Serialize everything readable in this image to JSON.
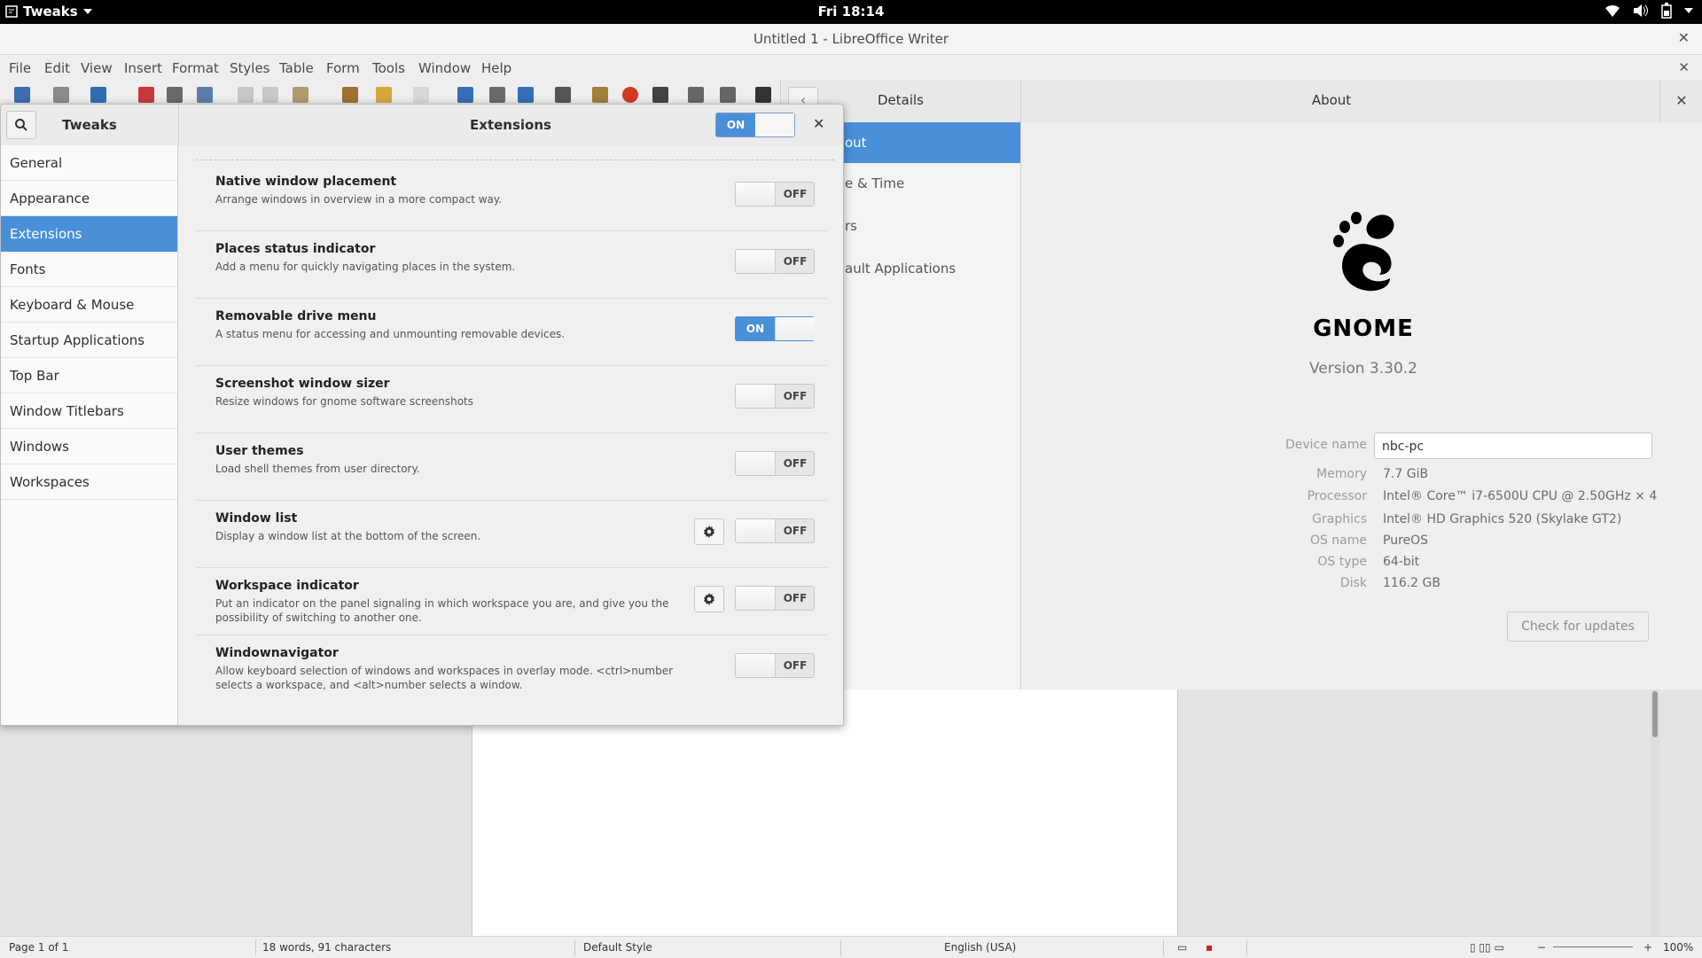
{
  "topbar": {
    "app_name": "Tweaks",
    "clock": "Fri 18:14",
    "icons": [
      "wifi-icon",
      "volume-icon",
      "battery-icon",
      "system-menu-arrow-icon"
    ]
  },
  "writer": {
    "title": "Untitled 1 - LibreOffice Writer",
    "menu": [
      "File",
      "Edit",
      "View",
      "Insert",
      "Format",
      "Styles",
      "Table",
      "Form",
      "Tools",
      "Window",
      "Help"
    ],
    "status": {
      "page": "Page 1 of 1",
      "words": "18 words, 91 characters",
      "style": "Default Style",
      "language": "English (USA)",
      "zoom": "100%"
    }
  },
  "settings": {
    "details_title": "Details",
    "about_title": "About",
    "sidebar": [
      "out",
      "e & Time",
      "rs",
      "ault Applications"
    ],
    "logo_text": "GNOME",
    "version": "Version 3.30.2",
    "device_name_label": "Device name",
    "device_name_value": "nbc-pc",
    "memory_label": "Memory",
    "memory_value": "7.7 GiB",
    "processor_label": "Processor",
    "processor_value": "Intel® Core™ i7-6500U CPU @ 2.50GHz × 4",
    "graphics_label": "Graphics",
    "graphics_value": "Intel® HD Graphics 520 (Skylake GT2)",
    "os_name_label": "OS name",
    "os_name_value": "PureOS",
    "os_type_label": "OS type",
    "os_type_value": "64-bit",
    "disk_label": "Disk",
    "disk_value": "116.2 GB",
    "check_updates": "Check for updates"
  },
  "tweaks": {
    "app_title": "Tweaks",
    "page_title": "Extensions",
    "master_switch": "ON",
    "sidebar": [
      "General",
      "Appearance",
      "Extensions",
      "Fonts",
      "Keyboard & Mouse",
      "Startup Applications",
      "Top Bar",
      "Window Titlebars",
      "Windows",
      "Workspaces"
    ],
    "active_item": "Extensions",
    "extensions": [
      {
        "name": "Native window placement",
        "desc": "Arrange windows in overview in a more compact way.",
        "state": "OFF",
        "gear": false
      },
      {
        "name": "Places status indicator",
        "desc": "Add a menu for quickly navigating places in the system.",
        "state": "OFF",
        "gear": false
      },
      {
        "name": "Removable drive menu",
        "desc": "A status menu for accessing and unmounting removable devices.",
        "state": "ON",
        "gear": false
      },
      {
        "name": "Screenshot window sizer",
        "desc": "Resize windows for gnome software screenshots",
        "state": "OFF",
        "gear": false
      },
      {
        "name": "User themes",
        "desc": "Load shell themes from user directory.",
        "state": "OFF",
        "gear": false
      },
      {
        "name": "Window list",
        "desc": "Display a window list at the bottom of the screen.",
        "state": "OFF",
        "gear": true
      },
      {
        "name": "Workspace indicator",
        "desc": "Put an indicator on the panel signaling in which workspace you are, and give you the possibility of switching to another one.",
        "state": "OFF",
        "gear": true
      },
      {
        "name": "Windownavigator",
        "desc": "Allow keyboard selection of windows and workspaces in overlay mode. <ctrl>number selects a workspace, and <alt>number selects a window.",
        "state": "OFF",
        "gear": false
      }
    ]
  },
  "colors": {
    "accent": "#4a90d9",
    "topbar": "#000000"
  }
}
